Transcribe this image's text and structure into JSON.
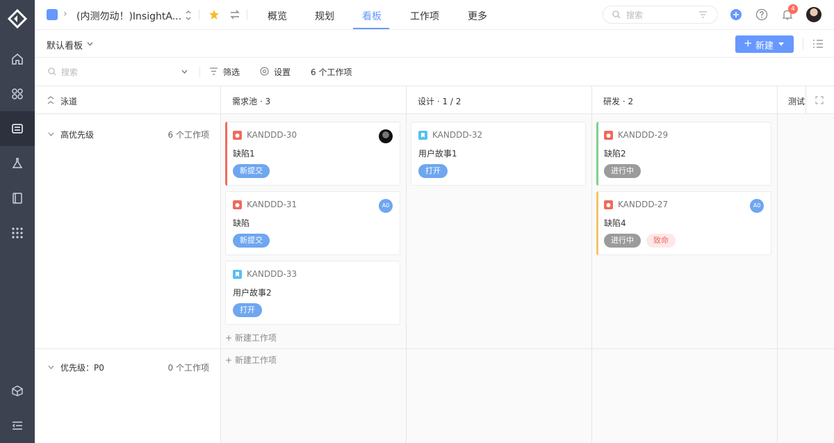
{
  "header": {
    "project_name": "(内测勿动！)InsightA...",
    "tabs": [
      {
        "label": "概览",
        "active": false
      },
      {
        "label": "规划",
        "active": false
      },
      {
        "label": "看板",
        "active": true
      },
      {
        "label": "工作项",
        "active": false
      },
      {
        "label": "更多",
        "active": false
      }
    ],
    "search_placeholder": "搜索",
    "notification_count": "4"
  },
  "board": {
    "title": "默认看板",
    "new_button": "新建"
  },
  "filterbar": {
    "search_placeholder": "搜索",
    "filter_label": "筛选",
    "settings_label": "设置",
    "count_label": "6 个工作项"
  },
  "columns": [
    {
      "label": "泳道"
    },
    {
      "label": "需求池 · 3"
    },
    {
      "label": "设计 · 1 / 2"
    },
    {
      "label": "研发 · 2"
    },
    {
      "label": "测试"
    }
  ],
  "lanes": [
    {
      "name": "高优先级",
      "count": "6 个工作项"
    },
    {
      "name": "优先级：P0",
      "count": "0 个工作项"
    }
  ],
  "cards": [
    {
      "id": "KANDDD-30",
      "title": "缺陷1",
      "type": "bug",
      "tags": [
        {
          "label": "新提交",
          "style": "blue"
        }
      ],
      "avatar": "photo",
      "bar_color": "#f06a5c"
    },
    {
      "id": "KANDDD-31",
      "title": "缺陷",
      "type": "bug",
      "tags": [
        {
          "label": "新提交",
          "style": "blue"
        }
      ],
      "avatar": "A0",
      "bar_color": ""
    },
    {
      "id": "KANDDD-33",
      "title": "用户故事2",
      "type": "story",
      "tags": [
        {
          "label": "打开",
          "style": "blue"
        }
      ],
      "avatar": "",
      "bar_color": ""
    },
    {
      "id": "KANDDD-32",
      "title": "用户故事1",
      "type": "story",
      "tags": [
        {
          "label": "打开",
          "style": "blue"
        }
      ],
      "avatar": "",
      "bar_color": ""
    },
    {
      "id": "KANDDD-29",
      "title": "缺陷2",
      "type": "bug",
      "tags": [
        {
          "label": "进行中",
          "style": "gray"
        }
      ],
      "avatar": "",
      "bar_color": "#7ed08c"
    },
    {
      "id": "KANDDD-27",
      "title": "缺陷4",
      "type": "bug",
      "tags": [
        {
          "label": "进行中",
          "style": "gray"
        },
        {
          "label": "致命",
          "style": "red"
        }
      ],
      "avatar": "A0",
      "bar_color": "#f5c46a"
    }
  ],
  "add_work_item_label": "新建工作项",
  "colors": {
    "accent": "#6698ff",
    "sidebar": "#3c4250",
    "bug_icon": "#f06a5c",
    "story_icon": "#56c0f0"
  }
}
